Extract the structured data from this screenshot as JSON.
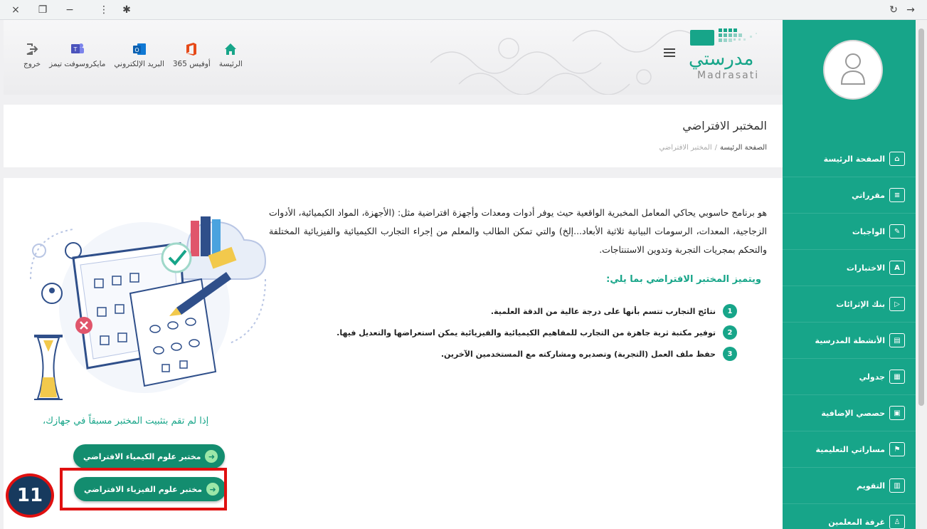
{
  "browser": {
    "close_glyph": "×",
    "restore_glyph": "❐",
    "minimize_glyph": "−",
    "menu_glyph": "⋮",
    "extension_glyph": "✱",
    "refresh_glyph": "↻",
    "forward_glyph": "→"
  },
  "header": {
    "links": [
      {
        "label": "الرئيسة",
        "icon": "home-icon"
      },
      {
        "label": "أوفيس 365",
        "icon": "office-icon"
      },
      {
        "label": "البريد الإلكتروني",
        "icon": "outlook-icon"
      },
      {
        "label": "مايكروسوفت تيمز",
        "icon": "teams-icon"
      },
      {
        "label": "خروج",
        "icon": "logout-icon"
      }
    ],
    "logo_text": "مدرستي",
    "logo_latin": "Madrasati"
  },
  "page": {
    "title": "المختبر الافتراضي",
    "breadcrumb_home": "الصفحة الرئيسة",
    "breadcrumb_sep": "/",
    "breadcrumb_current": "المختبر الافتراضي"
  },
  "content": {
    "intro": "هو برنامج حاسوبي يحاكي المعامل المخبرية الواقعية حيث يوفر أدوات ومعدات وأجهزة افتراضية مثل: (الأجهزة، المواد الكيميائية، الأدوات الزجاجية، المعدات، الرسومات البيانية ثلاثية الأبعاد...إلخ) والتي تمكن الطالب والمعلم من إجراء التجارب الكيميائية والفيزيائية المختلفة والتحكم بمجريات التجربة وتدوين الاستنتاجات.",
    "features_title": "ويتميز المختبر الافتراضي بما يلي:",
    "features": [
      {
        "num": "1",
        "text": "نتائج التجارب تتسم بأنها على درجة عالية من الدقة العلمية."
      },
      {
        "num": "2",
        "text": "توفير مكتبة ثرية جاهزة من التجارب للمفاهيم الكيميائية والفيزيائية يمكن استعراضها والتعديل فيها."
      },
      {
        "num": "3",
        "text": "حفظ ملف العمل (التجربة) وتصديره ومشاركته مع المستخدمين الآخرين."
      }
    ],
    "install_note": "إذا لم تقم بتثبيت المختبر مسبقاً في جهازك،",
    "chem_button": "مختبر علوم الكيمياء الافتراضي",
    "phys_button": "مختبر علوم الفيزياء الافتراضي",
    "step_number": "11"
  },
  "sidebar": {
    "items": [
      {
        "label": "الصفحة الرئيسة",
        "icon": "home-outline-icon",
        "glyph": "⌂"
      },
      {
        "label": "مقرراتي",
        "icon": "books-icon",
        "glyph": "≡"
      },
      {
        "label": "الواجبات",
        "icon": "edit-icon",
        "glyph": "✎"
      },
      {
        "label": "الاختبارات",
        "icon": "grade-icon",
        "glyph": "A"
      },
      {
        "label": "بنك الإثرائات",
        "icon": "media-icon",
        "glyph": "▷"
      },
      {
        "label": "الأنشطة المدرسية",
        "icon": "notepad-icon",
        "glyph": "▤"
      },
      {
        "label": "جدولي",
        "icon": "schedule-icon",
        "glyph": "▦"
      },
      {
        "label": "حصصي الإضافية",
        "icon": "extra-classes-icon",
        "glyph": "▣"
      },
      {
        "label": "مساراتي التعليمية",
        "icon": "paths-icon",
        "glyph": "⚑"
      },
      {
        "label": "التقويم",
        "icon": "calendar-icon",
        "glyph": "▥"
      },
      {
        "label": "غرفة المعلمين",
        "icon": "teachers-room-icon",
        "glyph": "♙"
      }
    ]
  },
  "colors": {
    "brand": "#17a589",
    "button": "#138d6f",
    "highlight": "#e01010",
    "badge": "#173a5e"
  }
}
